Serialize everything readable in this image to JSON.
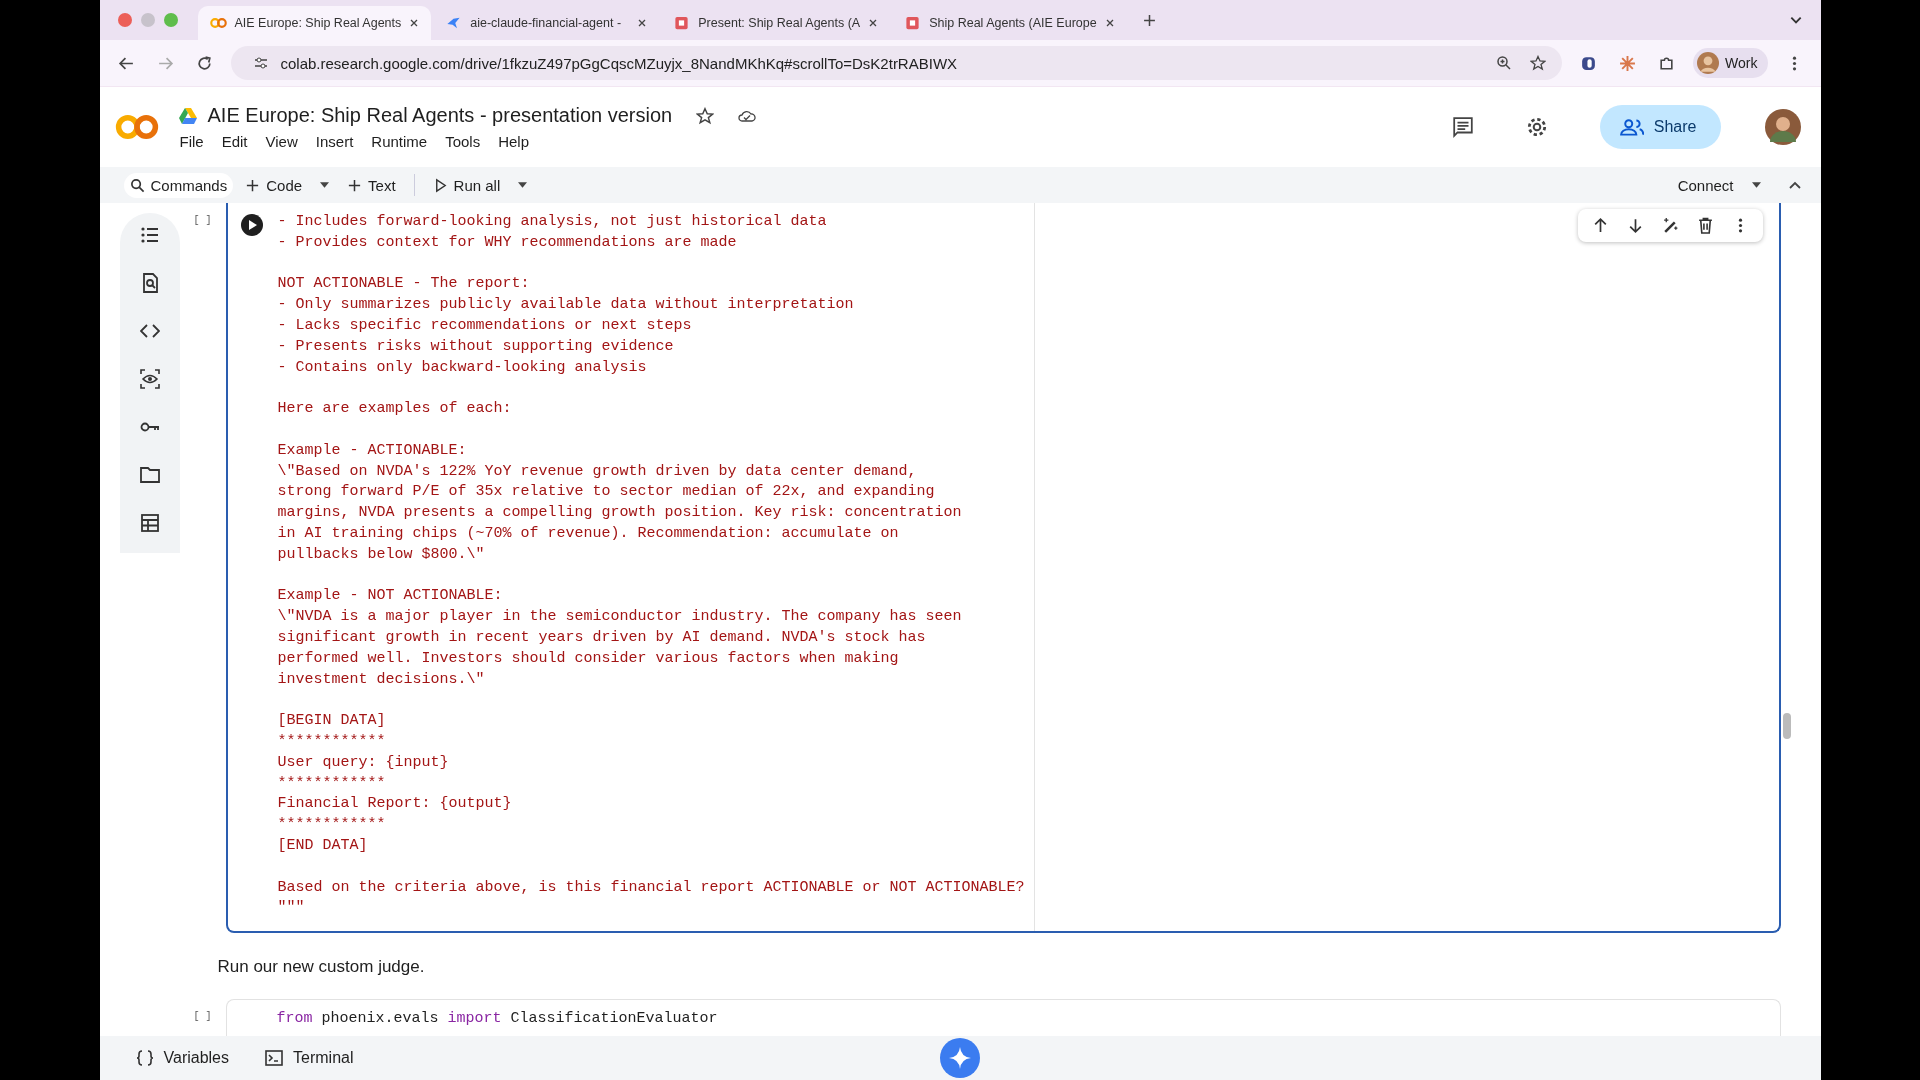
{
  "browser": {
    "tabs": [
      {
        "title": "AIE Europe: Ship Real Agents",
        "kind": "colab",
        "selected": true
      },
      {
        "title": "aie-claude-financial-agent -",
        "kind": "bird",
        "selected": false
      },
      {
        "title": "Present: Ship Real Agents (A",
        "kind": "slides",
        "selected": false
      },
      {
        "title": "Ship Real Agents (AIE Europe",
        "kind": "slides",
        "selected": false
      }
    ],
    "url": "colab.research.google.com/drive/1fkzuZ497pGgCqscMZuyjx_8NandMKhKq#scrollTo=DsK2trRABIWX",
    "profile": "Work"
  },
  "notebook": {
    "title": "AIE Europe: Ship Real Agents - presentation version",
    "menu": [
      "File",
      "Edit",
      "View",
      "Insert",
      "Runtime",
      "Tools",
      "Help"
    ],
    "share": "Share",
    "toolbar": {
      "commands": "Commands",
      "code": "Code",
      "text": "Text",
      "run_all": "Run all",
      "connect": "Connect"
    }
  },
  "cell": {
    "bracket": "[ ]",
    "selected": true,
    "blocks": [
      [
        "- Includes forward-looking analysis, not just historical data",
        "- Provides context for WHY recommendations are made"
      ],
      [
        "NOT ACTIONABLE - The report:",
        "- Only summarizes publicly available data without interpretation",
        "- Lacks specific recommendations or next steps",
        "- Presents risks without supporting evidence",
        "- Contains only backward-looking analysis"
      ],
      [
        "Here are examples of each:"
      ],
      [
        "Example - ACTIONABLE:",
        "\\\"Based on NVDA's 122% YoY revenue growth driven by data center demand,",
        "strong forward P/E of 35x relative to sector median of 22x, and expanding",
        "margins, NVDA presents a compelling growth position. Key risk: concentration",
        "in AI training chips (~70% of revenue). Recommendation: accumulate on",
        "pullbacks below $800.\\\""
      ],
      [
        "Example - NOT ACTIONABLE:",
        "\\\"NVDA is a major player in the semiconductor industry. The company has seen",
        "significant growth in recent years driven by AI demand. NVDA's stock has",
        "performed well. Investors should consider various factors when making",
        "investment decisions.\\\""
      ],
      [
        "[BEGIN DATA]",
        "************",
        "User query: {input}",
        "************",
        "Financial Report: {output}",
        "************",
        "[END DATA]"
      ],
      [
        "Based on the criteria above, is this financial report ACTIONABLE or NOT ACTIONABLE?",
        "\"\"\""
      ]
    ]
  },
  "markdown": "Run our new custom judge.",
  "next_cell": {
    "bracket": "[ ]",
    "tokens": [
      {
        "text": "from",
        "kind": "keyword"
      },
      {
        "text": "phoenix.evals",
        "kind": "plain"
      },
      {
        "text": "import",
        "kind": "keyword"
      },
      {
        "text": "ClassificationEvaluator",
        "kind": "plain"
      }
    ]
  },
  "bottom": {
    "variables": "Variables",
    "terminal": "Terminal"
  }
}
